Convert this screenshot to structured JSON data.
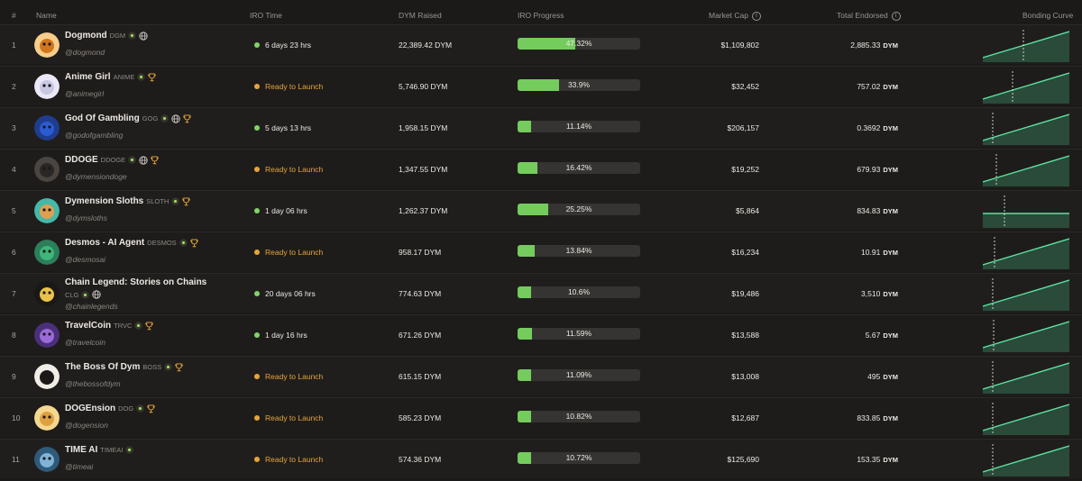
{
  "header": {
    "num": "#",
    "name": "Name",
    "iro_time": "IRO Time",
    "dym_raised": "DYM Raised",
    "iro_progress": "IRO Progress",
    "market_cap": "Market Cap",
    "total_endorsed": "Total Endorsed",
    "bonding_curve": "Bonding Curve",
    "info_glyph": "i"
  },
  "colors": {
    "accent_green": "#74cc5d",
    "active_dot": "#7fd466",
    "ready_orange": "#e6a53a",
    "curve_line": "#5be3a0",
    "curve_fill": "#2a4a3a"
  },
  "rows": [
    {
      "idx": "1",
      "name": "Dogmond",
      "ticker": "DGM",
      "handle": "@dogmond",
      "icons": [
        "dot",
        "globe"
      ],
      "iro_time": "6 days 23 hrs",
      "status": "active",
      "dym_raised": "22,389.42 DYM",
      "progress_label": "47.32%",
      "progress": 0.4732,
      "market_cap": "$1,109,802",
      "endorsed": "2,885.33",
      "endorsed_unit": "DYM",
      "curve": "rising",
      "marker": 0.47,
      "avatar_color": "#d2761e",
      "avatar_bg": "#f6cd8a"
    },
    {
      "idx": "2",
      "name": "Anime Girl",
      "ticker": "ANIME",
      "handle": "@animegirl",
      "icons": [
        "dot",
        "trophy"
      ],
      "iro_time": "Ready to Launch",
      "status": "ready",
      "dym_raised": "5,746.90 DYM",
      "progress_label": "33.9%",
      "progress": 0.339,
      "market_cap": "$32,452",
      "endorsed": "757.02",
      "endorsed_unit": "DYM",
      "curve": "rising",
      "marker": 0.34,
      "avatar_color": "#c9c7e4",
      "avatar_bg": "#eae8f6"
    },
    {
      "idx": "3",
      "name": "God Of Gambling",
      "ticker": "GOG",
      "handle": "@godofgambling",
      "icons": [
        "dot",
        "globe",
        "trophy"
      ],
      "iro_time": "5 days 13 hrs",
      "status": "active",
      "dym_raised": "1,958.15 DYM",
      "progress_label": "11.14%",
      "progress": 0.1114,
      "market_cap": "$206,157",
      "endorsed": "0.3692",
      "endorsed_unit": "DYM",
      "curve": "rising",
      "marker": 0.11,
      "avatar_color": "#2b5bd1",
      "avatar_bg": "#1f3d8f"
    },
    {
      "idx": "4",
      "name": "DDOGE",
      "ticker": "DDOGE",
      "handle": "@dymensiondoge",
      "icons": [
        "dot",
        "globe",
        "trophy"
      ],
      "iro_time": "Ready to Launch",
      "status": "ready",
      "dym_raised": "1,347.55 DYM",
      "progress_label": "16.42%",
      "progress": 0.1642,
      "market_cap": "$19,252",
      "endorsed": "679.93",
      "endorsed_unit": "DYM",
      "curve": "rising",
      "marker": 0.16,
      "avatar_color": "#2a2826",
      "avatar_bg": "#4a4540"
    },
    {
      "idx": "5",
      "name": "Dymension Sloths",
      "ticker": "SLOTH",
      "handle": "@dymsloths",
      "icons": [
        "dot",
        "trophy"
      ],
      "iro_time": "1 day 06 hrs",
      "status": "active",
      "dym_raised": "1,262.37 DYM",
      "progress_label": "25.25%",
      "progress": 0.2525,
      "market_cap": "$5,864",
      "endorsed": "834.83",
      "endorsed_unit": "DYM",
      "curve": "flat",
      "marker": 0.25,
      "avatar_color": "#e0a050",
      "avatar_bg": "#46b8a8"
    },
    {
      "idx": "6",
      "name": "Desmos - AI Agent",
      "ticker": "DESMOS",
      "handle": "@desmosai",
      "icons": [
        "dot",
        "trophy"
      ],
      "iro_time": "Ready to Launch",
      "status": "ready",
      "dym_raised": "958.17 DYM",
      "progress_label": "13.84%",
      "progress": 0.1384,
      "market_cap": "$16,234",
      "endorsed": "10.91",
      "endorsed_unit": "DYM",
      "curve": "rising",
      "marker": 0.14,
      "avatar_color": "#3fb67a",
      "avatar_bg": "#2c7f5a"
    },
    {
      "idx": "7",
      "name": "Chain Legend: Stories on Chains",
      "ticker": "CLG",
      "handle": "@chainlegends",
      "icons": [
        "dot",
        "globe"
      ],
      "iro_time": "20 days 06 hrs",
      "status": "active",
      "dym_raised": "774.63 DYM",
      "progress_label": "10.6%",
      "progress": 0.106,
      "market_cap": "$19,486",
      "endorsed": "3,510",
      "endorsed_unit": "DYM",
      "curve": "rising",
      "marker": 0.11,
      "avatar_color": "#e9c24a",
      "avatar_bg": "#1a1816"
    },
    {
      "idx": "8",
      "name": "TravelCoin",
      "ticker": "TRVC",
      "handle": "@travelcoin",
      "icons": [
        "dot",
        "trophy"
      ],
      "iro_time": "1 day 16 hrs",
      "status": "active",
      "dym_raised": "671.26 DYM",
      "progress_label": "11.59%",
      "progress": 0.1159,
      "market_cap": "$13,588",
      "endorsed": "5.67",
      "endorsed_unit": "DYM",
      "curve": "rising",
      "marker": 0.12,
      "avatar_color": "#9b6ad8",
      "avatar_bg": "#4a2f7a"
    },
    {
      "idx": "9",
      "name": "The Boss Of Dym",
      "ticker": "BOSS",
      "handle": "@thebossofdym",
      "icons": [
        "dot",
        "trophy"
      ],
      "iro_time": "Ready to Launch",
      "status": "ready",
      "dym_raised": "615.15 DYM",
      "progress_label": "11.09%",
      "progress": 0.1109,
      "market_cap": "$13,008",
      "endorsed": "495",
      "endorsed_unit": "DYM",
      "curve": "rising",
      "marker": 0.11,
      "avatar_color": "#1b1a19",
      "avatar_bg": "#f1ece6"
    },
    {
      "idx": "10",
      "name": "DOGEnsion",
      "ticker": "DOG",
      "handle": "@dogension",
      "icons": [
        "dot",
        "trophy"
      ],
      "iro_time": "Ready to Launch",
      "status": "ready",
      "dym_raised": "585.23 DYM",
      "progress_label": "10.82%",
      "progress": 0.1082,
      "market_cap": "$12,687",
      "endorsed": "833.85",
      "endorsed_unit": "DYM",
      "curve": "rising",
      "marker": 0.11,
      "avatar_color": "#e0a040",
      "avatar_bg": "#f4d890"
    },
    {
      "idx": "11",
      "name": "TIME AI",
      "ticker": "TIMEAI",
      "handle": "@timeai",
      "icons": [
        "dot"
      ],
      "iro_time": "Ready to Launch",
      "status": "ready",
      "dym_raised": "574.36 DYM",
      "progress_label": "10.72%",
      "progress": 0.1072,
      "market_cap": "$125,690",
      "endorsed": "153.35",
      "endorsed_unit": "DYM",
      "curve": "rising",
      "marker": 0.11,
      "avatar_color": "#7fb4d8",
      "avatar_bg": "#2f5a7a"
    }
  ]
}
